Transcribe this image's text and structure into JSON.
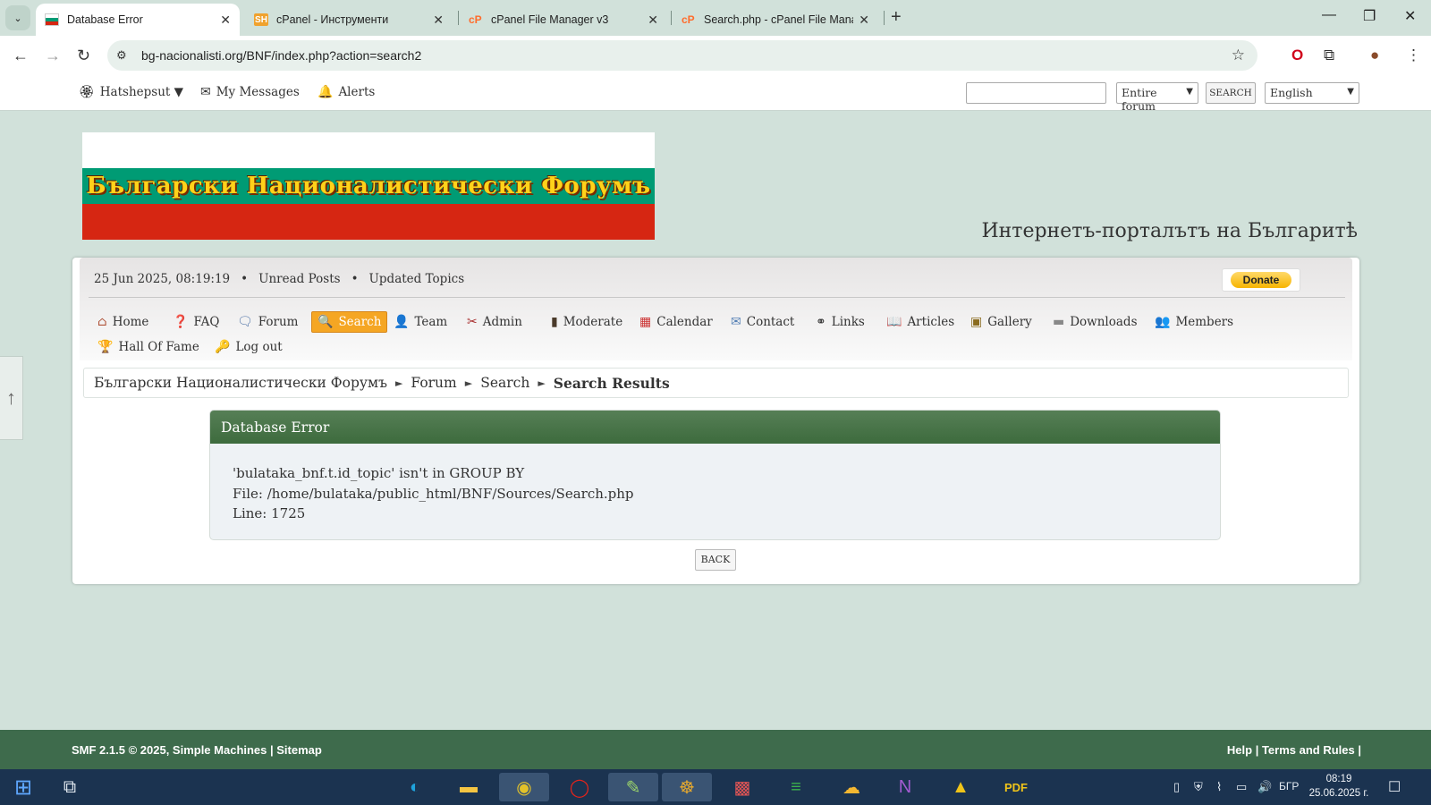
{
  "browser": {
    "tabs": [
      {
        "title": "Database Error",
        "active": true
      },
      {
        "title": "cPanel - Инструменти",
        "active": false
      },
      {
        "title": "cPanel File Manager v3",
        "active": false
      },
      {
        "title": "Search.php - cPanel File Manag",
        "active": false
      }
    ],
    "url": "bg-nacionalisti.org/BNF/index.php?action=search2"
  },
  "userbar": {
    "username": "Hatshepsut ▼",
    "messages": "My Messages",
    "alerts": "Alerts",
    "search_scope": "Entire forum",
    "search_button": "SEARCH",
    "language": "English"
  },
  "banner": {
    "logo_text": "Български Националистически Форумъ",
    "tagline": "Интернетъ-порталътъ на Българитѣ"
  },
  "infobar": {
    "datetime": "25 Jun 2025, 08:19:19",
    "unread": "Unread Posts",
    "updated": "Updated Topics",
    "donate": "Donate"
  },
  "menu": [
    {
      "label": "Home",
      "icon": "home-icon"
    },
    {
      "label": "FAQ",
      "icon": "help-icon"
    },
    {
      "label": "Forum",
      "icon": "speech-bubble-icon"
    },
    {
      "label": "Search",
      "icon": "magnifier-icon",
      "active": true
    },
    {
      "label": "Team",
      "icon": "person-icon"
    },
    {
      "label": "Admin",
      "icon": "tools-icon"
    },
    {
      "label": "Moderate",
      "icon": "traffic-light-icon"
    },
    {
      "label": "Calendar",
      "icon": "calendar-icon"
    },
    {
      "label": "Contact",
      "icon": "envelope-icon"
    },
    {
      "label": "Links",
      "icon": "chain-link-icon"
    },
    {
      "label": "Articles",
      "icon": "book-icon"
    },
    {
      "label": "Gallery",
      "icon": "album-icon"
    },
    {
      "label": "Downloads",
      "icon": "drive-icon"
    },
    {
      "label": "Members",
      "icon": "group-icon"
    },
    {
      "label": "Hall Of Fame",
      "icon": "trophy-icon"
    },
    {
      "label": "Log out",
      "icon": "key-icon"
    }
  ],
  "breadcrumb": [
    "Български Националистически Форумъ",
    "Forum",
    "Search",
    "Search Results"
  ],
  "error": {
    "title": "Database Error",
    "line1": "'bulataka_bnf.t.id_topic' isn't in GROUP BY",
    "line2": "File: /home/bulataka/public_html/BNF/Sources/Search.php",
    "line3": "Line: 1725",
    "back": "BACK"
  },
  "footer": {
    "left": "SMF 2.1.5 © 2025, Simple Machines | Sitemap",
    "right": "Help | Terms and Rules |"
  },
  "taskbar": {
    "lang": "БГР",
    "time": "08:19",
    "date": "25.06.2025 г."
  },
  "colors": {
    "page_bg": "#d1e1da",
    "accent_orange": "#f5a623",
    "error_header": "#4a744a",
    "footer_green": "#3e6b4c",
    "flag_green": "#009b74",
    "flag_red": "#d62612"
  }
}
